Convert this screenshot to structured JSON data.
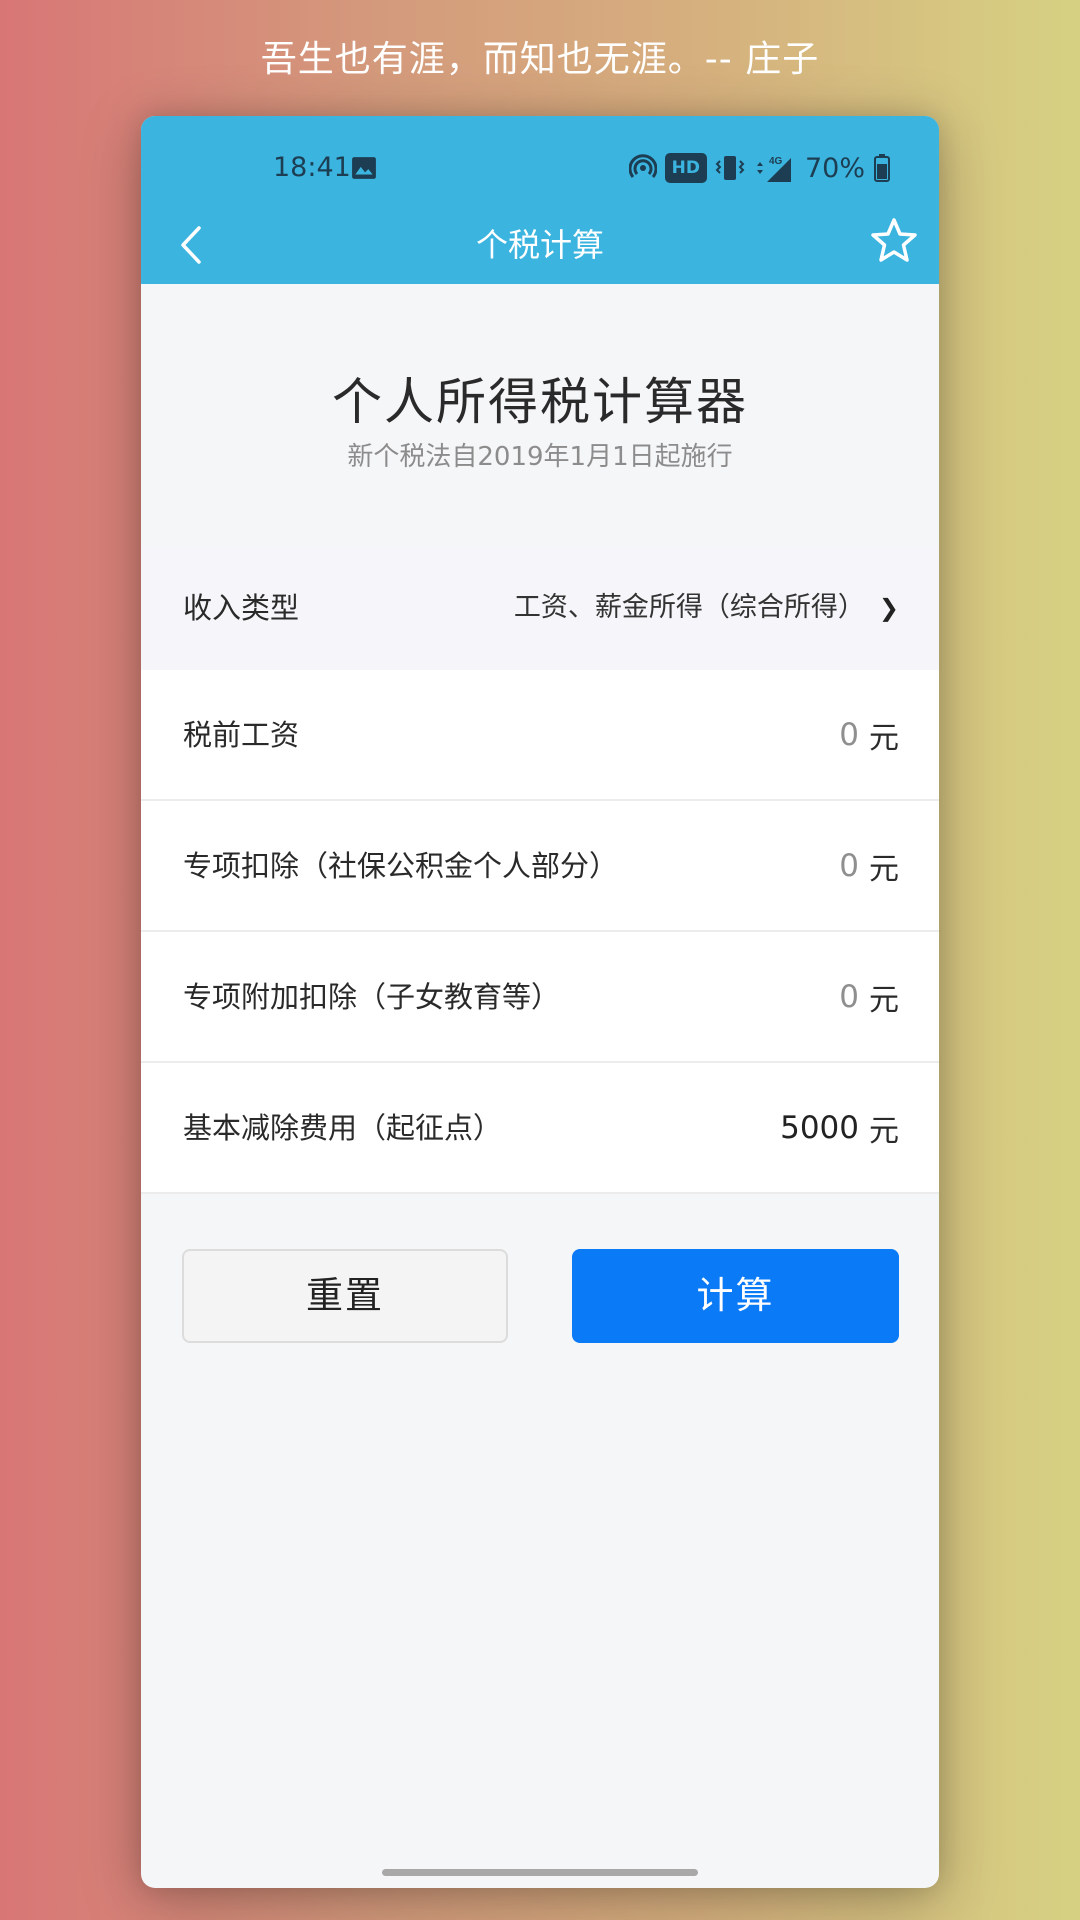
{
  "quote": "吾生也有涯，而知也无涯。-- 庄子",
  "status_bar": {
    "time": "18:41",
    "hd_badge": "HD",
    "network": "4G",
    "battery": "70%"
  },
  "nav": {
    "title": "个税计算",
    "back_icon": "chevron-left-icon",
    "favorite_icon": "star-outline-icon"
  },
  "header": {
    "title": "个人所得税计算器",
    "subtitle": "新个税法自2019年1月1日起施行"
  },
  "income_type": {
    "label": "收入类型",
    "value": "工资、薪金所得（综合所得）",
    "chevron": "❯"
  },
  "fields": [
    {
      "label": "税前工资",
      "value": "0",
      "unit": "元"
    },
    {
      "label": "专项扣除（社保公积金个人部分）",
      "value": "0",
      "unit": "元"
    },
    {
      "label": "专项附加扣除（子女教育等）",
      "value": "0",
      "unit": "元"
    },
    {
      "label": "基本减除费用（起征点）",
      "value": "5000",
      "unit": "元"
    }
  ],
  "buttons": {
    "reset": "重置",
    "calculate": "计算"
  },
  "colors": {
    "topbar": "#3bb4e0",
    "primary_button": "#0a7af7"
  }
}
